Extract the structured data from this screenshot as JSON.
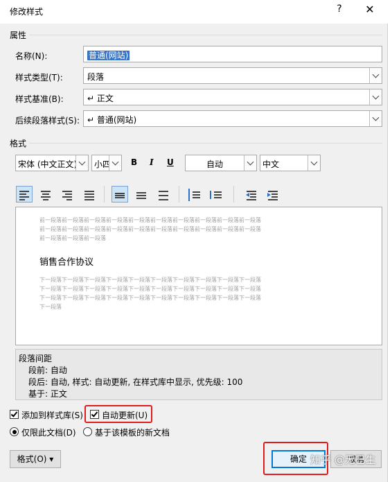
{
  "dialog": {
    "title": "修改样式",
    "help": "?",
    "close": "✕"
  },
  "properties": {
    "section": "属性",
    "name_label": "名称(N):",
    "name_value": "普通(网站)",
    "type_label": "样式类型(T):",
    "type_value": "段落",
    "based_label": "样式基准(B):",
    "based_value": "↵ 正文",
    "next_label": "后续段落样式(S):",
    "next_value": "↵ 普通(网站)"
  },
  "format": {
    "section": "格式",
    "font": "宋体 (中文正文)",
    "size": "小四",
    "bold": "B",
    "italic": "I",
    "underline": "U",
    "color": "自动",
    "script": "中文"
  },
  "preview": {
    "prev_line1": "前一段落前一段落前一段落前一段落前一段落前一段落前一段落前一段落前一段落前一段落",
    "prev_line2": "前一段落前一段落前一段落前一段落前一段落前一段落前一段落前一段落前一段落前一段落",
    "prev_line3": "前一段落前一段落前一段落",
    "sample": "销售合作协议",
    "next_line1": "下一段落下一段落下一段落下一段落下一段落下一段落下一段落下一段落下一段落下一段落",
    "next_line2": "下一段落下一段落下一段落下一段落下一段落下一段落下一段落下一段落下一段落下一段落",
    "next_line3": "下一段落下一段落下一段落下一段落下一段落下一段落下一段落下一段落下一段落下一段落",
    "next_line4": "下一段落"
  },
  "description": {
    "line1": "段落间距",
    "line2": "段前: 自动",
    "line3": "段后: 自动, 样式: 自动更新, 在样式库中显示, 优先级: 100",
    "line4": "基于: 正文"
  },
  "options": {
    "add_to_gallery": "添加到样式库(S)",
    "add_to_gallery_checked": true,
    "auto_update": "自动更新(U)",
    "auto_update_checked": true,
    "only_this_doc": "仅限此文档(D)",
    "new_docs_template": "基于该模板的新文档"
  },
  "buttons": {
    "format": "格式(O) ▾",
    "ok": "确定",
    "cancel": "取消"
  },
  "watermark": "知乎 @无巳生",
  "colors": {
    "highlight_red": "#e01b1b",
    "selection_blue": "#3574c9",
    "default_button_border": "#0078d7"
  }
}
